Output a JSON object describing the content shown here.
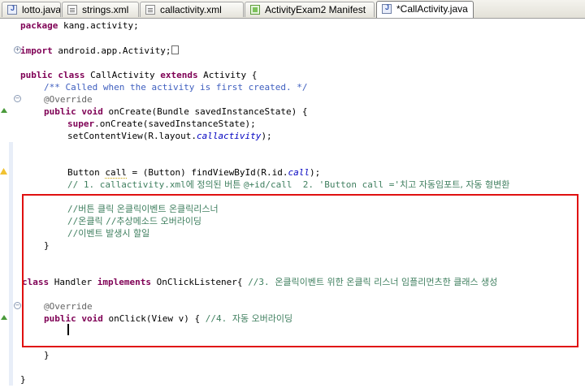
{
  "tabs": [
    {
      "label": "lotto.java",
      "icon": "java-file-icon",
      "active": false
    },
    {
      "label": "strings.xml",
      "icon": "xml-file-icon",
      "active": false
    },
    {
      "label": "callactivity.xml",
      "icon": "xml-file-icon",
      "active": false
    },
    {
      "label": "ActivityExam2 Manifest",
      "icon": "manifest-icon",
      "active": false
    },
    {
      "label": "*CallActivity.java",
      "icon": "java-file-icon",
      "active": true
    }
  ],
  "code": {
    "package": {
      "kw": "package",
      "rest": " kang.activity;"
    },
    "import": {
      "kw": "import",
      "rest": " android.app.Activity;"
    },
    "class_decl": {
      "kw1": "public class",
      "name": " CallActivity ",
      "kw2": "extends",
      "rest": " Activity {"
    },
    "javadoc": "/** Called when the activity is first created. */",
    "override1": "@Override",
    "oncreate": {
      "kw": "public void",
      "rest": " onCreate(Bundle savedInstanceState) {"
    },
    "super_call": {
      "kw": "super",
      "rest": ".onCreate(savedInstanceState);"
    },
    "setcontent": {
      "pre": "setContentView(R.layout.",
      "field": "callactivity",
      "post": ");"
    },
    "button_line": {
      "pre": "Button ",
      "var": "call",
      "mid": " = (Button) findViewById(R.id.",
      "field": "call",
      "post": ");"
    },
    "comment1": {
      "code": "// 1. callactivity.xml",
      "ko1": "에 정의된 버튼 ",
      "code2": "@+id/call  2. 'Button call ='",
      "ko2": "치고 자동임포트, 자동 형변환"
    },
    "comment_a": {
      "code": "//",
      "ko": "버튼 클릭 온클릭이벤트 온클릭리스너"
    },
    "comment_b": {
      "code": "//",
      "ko": "온클릭 ",
      "code2": "//",
      "ko2": "추상메소드 오버라이딩"
    },
    "comment_c": {
      "code": "//",
      "ko": "이벤트 발생시 할일"
    },
    "close_brace1": "}",
    "handler_decl": {
      "kw1": "class",
      "name": " Handler ",
      "kw2": "implements",
      "rest": " OnClickListener{ ",
      "cm_code": "//3. ",
      "cm_ko": "온클릭이벤트 위한 온클릭 리스너 임플리먼츠한 클래스 생성"
    },
    "override2": "@Override",
    "onclick": {
      "kw": "public void",
      "rest": " onClick(View v) { ",
      "cm_code": "//4. ",
      "cm_ko": "자동 오버라이딩"
    },
    "close_brace2": "}",
    "close_brace3": "}"
  }
}
